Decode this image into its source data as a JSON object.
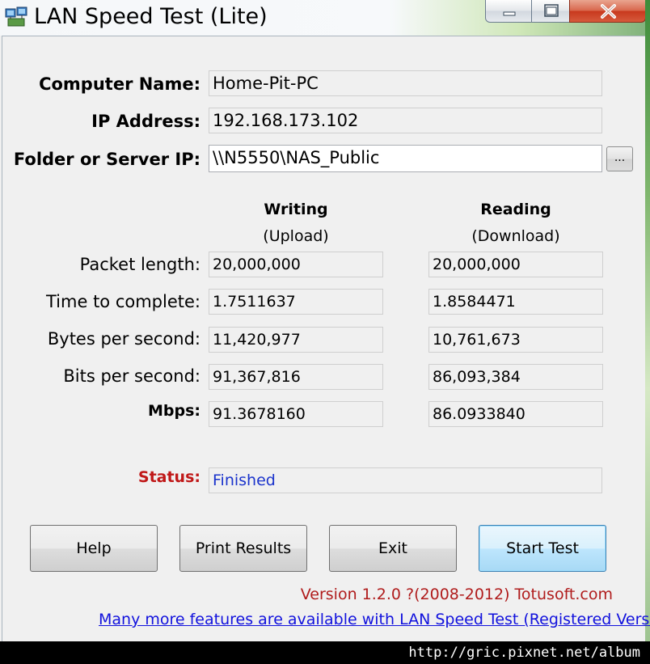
{
  "window": {
    "title": "LAN Speed Test (Lite)",
    "minimize_glyph": "—",
    "maximize_glyph": "☐",
    "close_glyph": "✕"
  },
  "info": {
    "computer_name_label": "Computer Name:",
    "computer_name_value": "Home-Pit-PC",
    "ip_label": "IP Address:",
    "ip_value": "192.168.173.102",
    "folder_label": "Folder or Server IP:",
    "folder_value": "\\\\N5550\\NAS_Public",
    "browse_label": "..."
  },
  "columns": {
    "writing": "Writing",
    "writing_sub": "(Upload)",
    "reading": "Reading",
    "reading_sub": "(Download)"
  },
  "results": {
    "rows": [
      {
        "label": "Packet length:",
        "writing": "20,000,000",
        "reading": "20,000,000"
      },
      {
        "label": "Time to complete:",
        "writing": "1.7511637",
        "reading": "1.8584471"
      },
      {
        "label": "Bytes per second:",
        "writing": "11,420,977",
        "reading": "10,761,673"
      },
      {
        "label": "Bits per second:",
        "writing": "91,367,816",
        "reading": "86,093,384"
      },
      {
        "label": "Mbps:",
        "writing": "91.3678160",
        "reading": "86.0933840"
      }
    ]
  },
  "status": {
    "label": "Status:",
    "value": "Finished"
  },
  "buttons": {
    "help": "Help",
    "print": "Print Results",
    "exit": "Exit",
    "start": "Start Test"
  },
  "footer": {
    "version": "Version 1.2.0  ?(2008-2012) Totusoft.com",
    "link": "Many more features are available with LAN Speed Test (Registered Version)"
  },
  "watermark": "http://gric.pixnet.net/album",
  "colors": {
    "status_label": "#c01818",
    "status_value": "#1a33cc",
    "version_text": "#b01c1c",
    "link_text": "#1111dd"
  },
  "icons": [
    "app-icon",
    "minimize-icon",
    "maximize-icon",
    "close-icon"
  ]
}
